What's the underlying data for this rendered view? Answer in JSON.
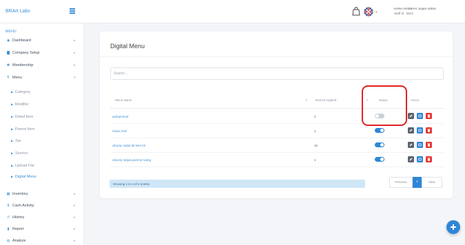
{
  "header": {
    "brand": "BRArt Labs",
    "user_name": "HANA HAMBAH, Super Admin",
    "staff_id": "Staff Id : 0644",
    "lang_caret": "▾"
  },
  "sidebar": {
    "title": "MENU",
    "top_items": [
      {
        "label": "Dashboard",
        "icon": "dashboard-icon"
      },
      {
        "label": "Company Setup",
        "icon": "building-icon"
      },
      {
        "label": "Membership",
        "icon": "members-icon"
      },
      {
        "label": "Menu",
        "icon": "menu-icon"
      }
    ],
    "sub_items": [
      "Category",
      "Modifier",
      "Detail Item",
      "Parent Item",
      "Tax",
      "Service",
      "Upload File",
      "Digital Menu"
    ],
    "bottom_items": [
      {
        "label": "Inventory",
        "icon": "inventory-icon"
      },
      {
        "label": "Cash Activity",
        "icon": "dollar-icon"
      },
      {
        "label": "History",
        "icon": "history-icon"
      },
      {
        "label": "Report",
        "icon": "report-icon"
      },
      {
        "label": "Analyze",
        "icon": "analyze-icon"
      }
    ],
    "active_sub": "Digital Menu"
  },
  "main": {
    "title": "Digital Menu",
    "search_placeholder": "Search...",
    "columns": [
      "Menu Name",
      "Branch Applied",
      "Status",
      "Action"
    ],
    "rows": [
      {
        "name": "ambutchoot",
        "branch_count": "2",
        "status": false
      },
      {
        "name": "Garia Ariel",
        "branch_count": "1",
        "status": true
      },
      {
        "name": "ciburay salad all item k3",
        "branch_count": "12",
        "status": true
      },
      {
        "name": "ciburay sarpa parenst ruang",
        "branch_count": "1",
        "status": true
      }
    ],
    "showing": "Showing 1 to 4 of 4 entries",
    "pagination": {
      "prev": "Previous",
      "current": "1",
      "next": "Next"
    }
  },
  "colors": {
    "accent": "#2f86d6",
    "delete": "#e53935",
    "highlight": "#e02020"
  }
}
